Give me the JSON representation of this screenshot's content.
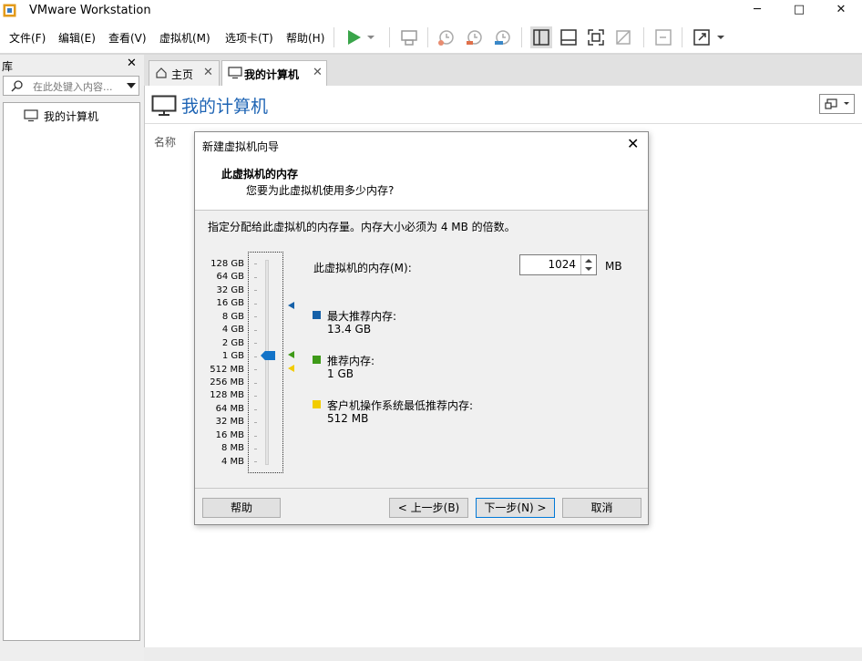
{
  "app": {
    "title": "VMware Workstation",
    "minimize": "─",
    "maximize": "□",
    "close": "✕"
  },
  "menu": [
    "文件(F)",
    "编辑(E)",
    "查看(V)",
    "虚拟机(M)",
    "选项卡(T)",
    "帮助(H)"
  ],
  "toolbar": {
    "play_color": "#3aa54a",
    "icons": [
      "play-icon",
      "play-dropdown-icon",
      "send-keys-icon",
      "snapshot-icon",
      "revert-snapshot-icon",
      "snapshot-manager-icon",
      "show-library-icon",
      "thumbnail-bar-icon",
      "full-screen-icon",
      "unity-icon",
      "console-icon",
      "stretch-icon",
      "stretch-dropdown-icon"
    ]
  },
  "library": {
    "title": "库",
    "close": "✕",
    "search_placeholder": "在此处键入内容...",
    "tree": [
      {
        "label": "我的计算机",
        "icon": "computer-icon"
      }
    ]
  },
  "tabs": [
    {
      "label": "主页",
      "icon": "home-icon",
      "close": "✕"
    },
    {
      "label": "我的计算机",
      "icon": "computer-icon",
      "close": "✕",
      "active": true
    }
  ],
  "main": {
    "title": "我的计算机",
    "title_color": "#1e64b4",
    "column_name": "名称"
  },
  "dialog": {
    "title": "新建虚拟机向导",
    "close": "✕",
    "heading": "此虚拟机的内存",
    "subheading": "您要为此虚拟机使用多少内存?",
    "intro": "指定分配给此虚拟机的内存量。内存大小必须为 4 MB 的倍数。",
    "scale": [
      "128 GB",
      "64 GB",
      "32 GB",
      "16 GB",
      "8 GB",
      "4 GB",
      "2 GB",
      "1 GB",
      "512 MB",
      "256 MB",
      "128 MB",
      "64 MB",
      "32 MB",
      "16 MB",
      "8 MB",
      "4 MB"
    ],
    "memory_label": "此虚拟机的内存(M):",
    "memory_value": "1024",
    "memory_unit": "MB",
    "legend": [
      {
        "label": "最大推荐内存:",
        "value": "13.4 GB",
        "color": "#1560a8"
      },
      {
        "label": "推荐内存:",
        "value": "1 GB",
        "color": "#3e9a18"
      },
      {
        "label": "客户机操作系统最低推荐内存:",
        "value": "512 MB",
        "color": "#f2cc00"
      }
    ],
    "buttons": {
      "help": "帮助",
      "back": "< 上一步(B)",
      "next": "下一步(N) >",
      "cancel": "取消"
    }
  }
}
